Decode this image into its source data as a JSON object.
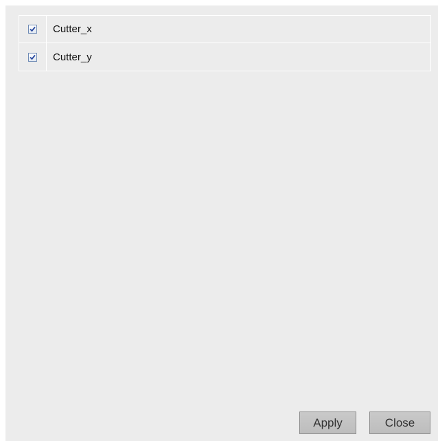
{
  "items": [
    {
      "label": "Cutter_x",
      "checked": true
    },
    {
      "label": "Cutter_y",
      "checked": true
    }
  ],
  "buttons": {
    "apply_label": "Apply",
    "close_label": "Close"
  },
  "colors": {
    "panel_bg": "#ececec",
    "button_bg": "#c4c4c4",
    "check_mark": "#2a4aa0"
  },
  "icons": {
    "checkbox_checked": "check-icon"
  }
}
